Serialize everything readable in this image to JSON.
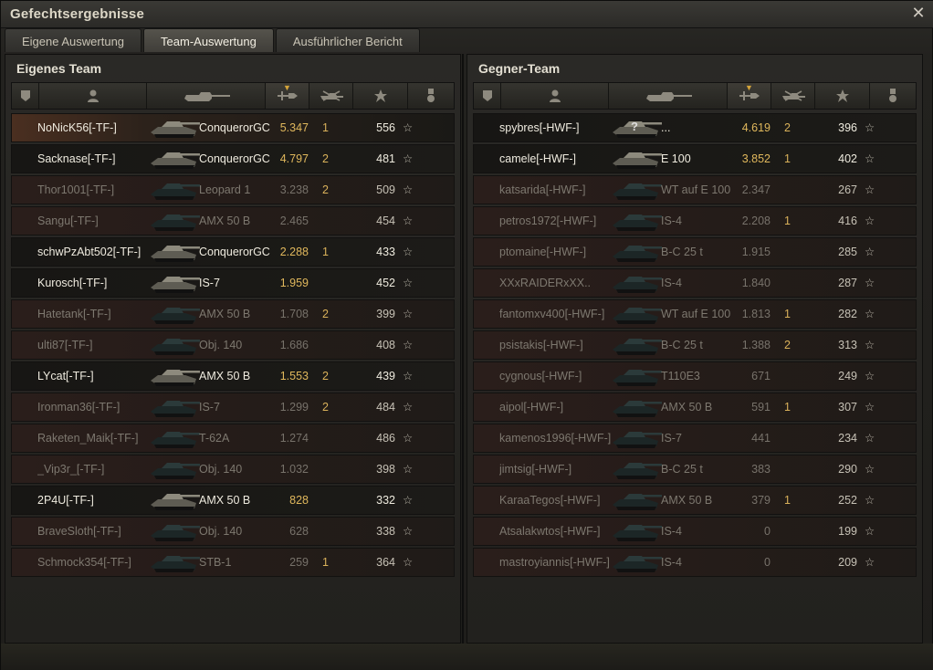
{
  "window": {
    "title": "Gefechtsergebnisse"
  },
  "tabs": [
    {
      "label": "Eigene Auswertung",
      "active": false
    },
    {
      "label": "Team-Auswertung",
      "active": true
    },
    {
      "label": "Ausführlicher Bericht",
      "active": false
    }
  ],
  "left_team": {
    "title": "Eigenes Team",
    "rows": [
      {
        "name": "NoNicK56[-TF-]",
        "tank": "ConquerorGC",
        "damage": "5.347",
        "kills": "1",
        "xp": "556",
        "alive": true,
        "player": true
      },
      {
        "name": "Sacknase[-TF-]",
        "tank": "ConquerorGC",
        "damage": "4.797",
        "kills": "2",
        "xp": "481",
        "alive": true
      },
      {
        "name": "Thor1001[-TF-]",
        "tank": "Leopard 1",
        "damage": "3.238",
        "kills": "2",
        "xp": "509",
        "alive": false
      },
      {
        "name": "Sangu[-TF-]",
        "tank": "AMX 50 B",
        "damage": "2.465",
        "kills": "",
        "xp": "454",
        "alive": false
      },
      {
        "name": "schwPzAbt502[-TF-]",
        "tank": "ConquerorGC",
        "damage": "2.288",
        "kills": "1",
        "xp": "433",
        "alive": true
      },
      {
        "name": "Kurosch[-TF-]",
        "tank": "IS-7",
        "damage": "1.959",
        "kills": "",
        "xp": "452",
        "alive": true
      },
      {
        "name": "Hatetank[-TF-]",
        "tank": "AMX 50 B",
        "damage": "1.708",
        "kills": "2",
        "xp": "399",
        "alive": false
      },
      {
        "name": "ulti87[-TF-]",
        "tank": "Obj. 140",
        "damage": "1.686",
        "kills": "",
        "xp": "408",
        "alive": false
      },
      {
        "name": "LYcat[-TF-]",
        "tank": "AMX 50 B",
        "damage": "1.553",
        "kills": "2",
        "xp": "439",
        "alive": true
      },
      {
        "name": "Ironman36[-TF-]",
        "tank": "IS-7",
        "damage": "1.299",
        "kills": "2",
        "xp": "484",
        "alive": false
      },
      {
        "name": "Raketen_Maik[-TF-]",
        "tank": "T-62A",
        "damage": "1.274",
        "kills": "",
        "xp": "486",
        "alive": false
      },
      {
        "name": "_Vip3r_[-TF-]",
        "tank": "Obj. 140",
        "damage": "1.032",
        "kills": "",
        "xp": "398",
        "alive": false
      },
      {
        "name": "2P4U[-TF-]",
        "tank": "AMX 50 B",
        "damage": "828",
        "kills": "",
        "xp": "332",
        "alive": true
      },
      {
        "name": "BraveSloth[-TF-]",
        "tank": "Obj. 140",
        "damage": "628",
        "kills": "",
        "xp": "338",
        "alive": false
      },
      {
        "name": "Schmock354[-TF-]",
        "tank": "STB-1",
        "damage": "259",
        "kills": "1",
        "xp": "364",
        "alive": false
      }
    ]
  },
  "right_team": {
    "title": "Gegner-Team",
    "rows": [
      {
        "name": "spybres[-HWF-]",
        "tank": "...",
        "damage": "4.619",
        "kills": "2",
        "xp": "396",
        "alive": true,
        "unknown": true
      },
      {
        "name": "camele[-HWF-]",
        "tank": "E 100",
        "damage": "3.852",
        "kills": "1",
        "xp": "402",
        "alive": true
      },
      {
        "name": "katsarida[-HWF-]",
        "tank": "WT auf E 100",
        "damage": "2.347",
        "kills": "",
        "xp": "267",
        "alive": false
      },
      {
        "name": "petros1972[-HWF-]",
        "tank": "IS-4",
        "damage": "2.208",
        "kills": "1",
        "xp": "416",
        "alive": false
      },
      {
        "name": "ptomaine[-HWF-]",
        "tank": "B-C 25 t",
        "damage": "1.915",
        "kills": "",
        "xp": "285",
        "alive": false
      },
      {
        "name": "XXxRAIDERxXX..",
        "tank": "IS-4",
        "damage": "1.840",
        "kills": "",
        "xp": "287",
        "alive": false
      },
      {
        "name": "fantomxv400[-HWF-]",
        "tank": "WT auf E 100",
        "damage": "1.813",
        "kills": "1",
        "xp": "282",
        "alive": false
      },
      {
        "name": "psistakis[-HWF-]",
        "tank": "B-C 25 t",
        "damage": "1.388",
        "kills": "2",
        "xp": "313",
        "alive": false
      },
      {
        "name": "cygnous[-HWF-]",
        "tank": "T110E3",
        "damage": "671",
        "kills": "",
        "xp": "249",
        "alive": false
      },
      {
        "name": "aipol[-HWF-]",
        "tank": "AMX 50 B",
        "damage": "591",
        "kills": "1",
        "xp": "307",
        "alive": false
      },
      {
        "name": "kamenos1996[-HWF-]",
        "tank": "IS-7",
        "damage": "441",
        "kills": "",
        "xp": "234",
        "alive": false
      },
      {
        "name": "jimtsig[-HWF-]",
        "tank": "B-C 25 t",
        "damage": "383",
        "kills": "",
        "xp": "290",
        "alive": false
      },
      {
        "name": "KaraaTegos[-HWF-]",
        "tank": "AMX 50 B",
        "damage": "379",
        "kills": "1",
        "xp": "252",
        "alive": false
      },
      {
        "name": "Atsalakwtos[-HWF-]",
        "tank": "IS-4",
        "damage": "0",
        "kills": "",
        "xp": "199",
        "alive": false
      },
      {
        "name": "mastroyiannis[-HWF-]",
        "tank": "IS-4",
        "damage": "0",
        "kills": "",
        "xp": "209",
        "alive": false
      }
    ]
  },
  "icons": {
    "close": "close-icon",
    "star_glyph": "☆",
    "header": [
      "platoon-icon",
      "player-icon",
      "tank-icon",
      "damage-icon",
      "kills-icon",
      "xp-star-icon",
      "medal-icon"
    ]
  },
  "colors": {
    "accent": "#d5a53a",
    "dead_row": "#2a1e1b",
    "alive_row": "#1a1916"
  }
}
